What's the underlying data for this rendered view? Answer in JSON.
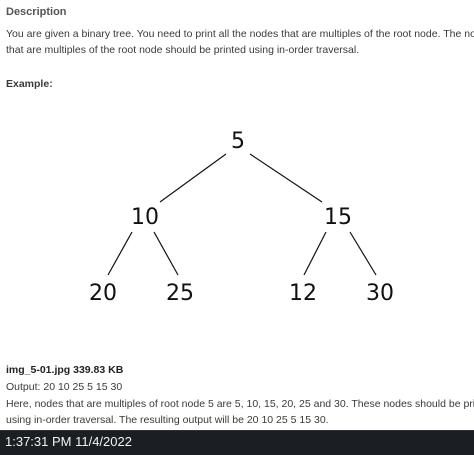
{
  "content": {
    "section_title": "Description",
    "description_lines": [
      "You are given a binary tree. You need to print all the nodes that are multiples of the root node. The nodes",
      "that are multiples of the root node should be printed using in-order traversal."
    ],
    "example_label": "Example:",
    "tree": {
      "nodes": [
        {
          "id": "root",
          "value": "5"
        },
        {
          "id": "left",
          "value": "10"
        },
        {
          "id": "right",
          "value": "15"
        },
        {
          "id": "left-left",
          "value": "20"
        },
        {
          "id": "left-right",
          "value": "25"
        },
        {
          "id": "right-left",
          "value": "12"
        },
        {
          "id": "right-right",
          "value": "30"
        }
      ],
      "edges": [
        [
          "root",
          "left"
        ],
        [
          "root",
          "right"
        ],
        [
          "left",
          "left-left"
        ],
        [
          "left",
          "left-right"
        ],
        [
          "right",
          "right-left"
        ],
        [
          "right",
          "right-right"
        ]
      ]
    },
    "attachment": "img_5-01.jpg 339.83 KB",
    "output_line": "Output: 20 10 25 5 15 30",
    "explanation_lines": [
      "Here, nodes that are multiples of root node 5 are 5, 10, 15, 20, 25 and 30. These nodes should be printed",
      "using in-order traversal. The resulting output will be 20 10 25 5 15 30."
    ]
  },
  "taskbar": {
    "clock": "1:37:31 PM 11/4/2022"
  }
}
